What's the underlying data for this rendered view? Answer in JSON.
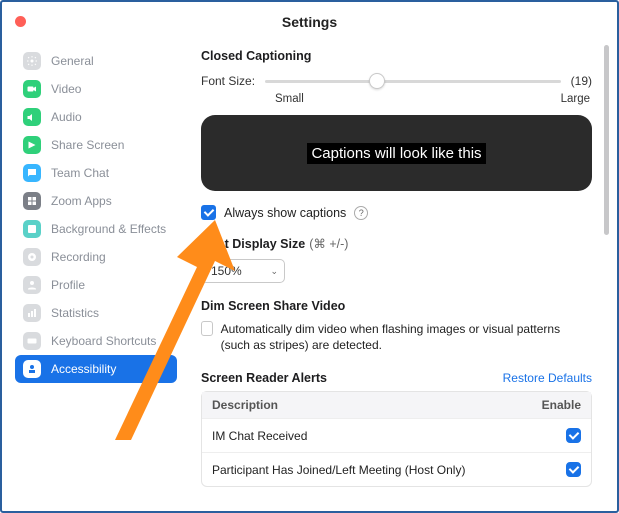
{
  "window": {
    "title": "Settings"
  },
  "sidebar": {
    "items": [
      {
        "label": "General",
        "color": "#d9dbde"
      },
      {
        "label": "Video",
        "color": "#2fd07a"
      },
      {
        "label": "Audio",
        "color": "#2fd07a"
      },
      {
        "label": "Share Screen",
        "color": "#2fd07a"
      },
      {
        "label": "Team Chat",
        "color": "#38b6ff"
      },
      {
        "label": "Zoom Apps",
        "color": "#7b7f87"
      },
      {
        "label": "Background & Effects",
        "color": "#5ad1c8"
      },
      {
        "label": "Recording",
        "color": "#d9dbde"
      },
      {
        "label": "Profile",
        "color": "#d9dbde"
      },
      {
        "label": "Statistics",
        "color": "#d9dbde"
      },
      {
        "label": "Keyboard Shortcuts",
        "color": "#d9dbde"
      },
      {
        "label": "Accessibility",
        "color": "#ffffff"
      }
    ],
    "active_index": 11
  },
  "closed_captioning": {
    "title": "Closed Captioning",
    "font_size_label": "Font Size:",
    "font_size_value": "(19)",
    "slider_pos_pct": 38,
    "small_label": "Small",
    "large_label": "Large",
    "preview_text": "Captions will look like this",
    "always_show_label": "Always show captions",
    "always_show_checked": true
  },
  "chat_display": {
    "title": "Chat Display Size",
    "shortcut": "(⌘ +/-)",
    "value": "150%"
  },
  "dim": {
    "title": "Dim Screen Share Video",
    "checkbox_label": "Automatically dim video when flashing images or visual patterns (such as stripes) are detected.",
    "checked": false
  },
  "screen_reader": {
    "title": "Screen Reader Alerts",
    "restore": "Restore Defaults",
    "columns": {
      "desc": "Description",
      "enable": "Enable"
    },
    "rows": [
      {
        "desc": "IM Chat Received",
        "enabled": true
      },
      {
        "desc": "Participant Has Joined/Left Meeting (Host Only)",
        "enabled": true
      }
    ]
  }
}
